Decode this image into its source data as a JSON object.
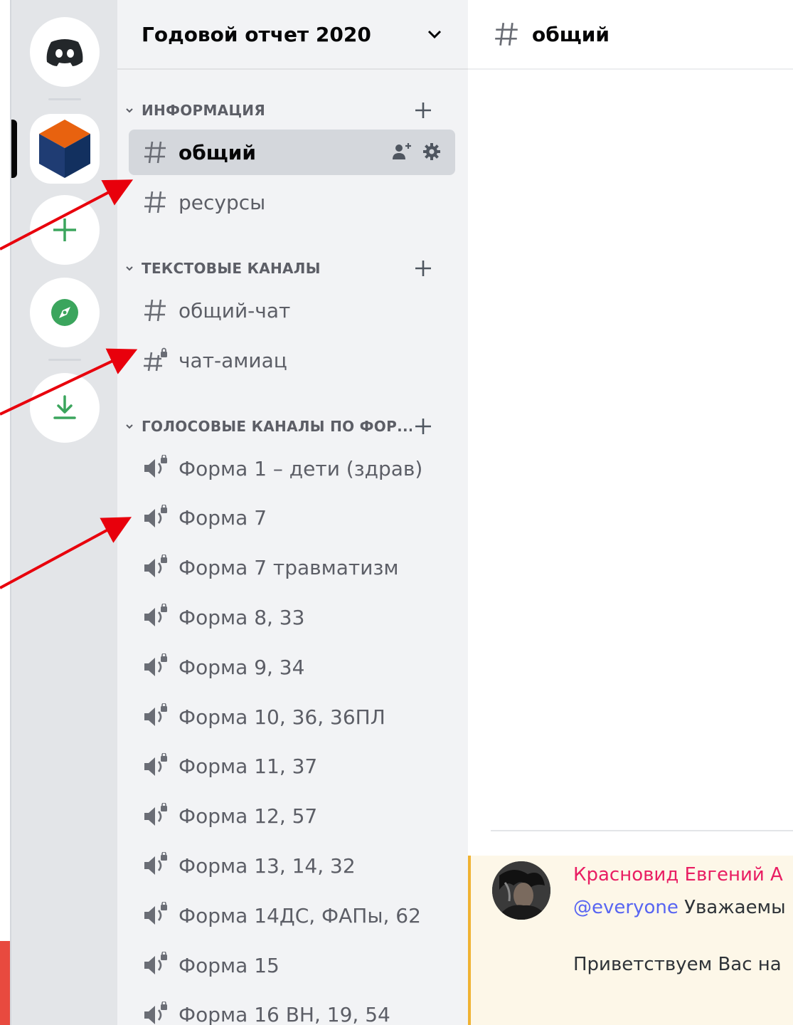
{
  "server": {
    "name": "Годовой отчет 2020"
  },
  "categories": [
    {
      "label": "ИНФОРМАЦИЯ"
    },
    {
      "label": "ТЕКСТОВЫЕ КАНАЛЫ"
    },
    {
      "label": "ГОЛОСОВЫЕ КАНАЛЫ ПО ФОР..."
    }
  ],
  "channels": {
    "info": [
      "общий",
      "ресурсы"
    ],
    "text": [
      "общий-чат",
      "чат-амиац"
    ],
    "voice": [
      "Форма 1 – дети (здрав)",
      "Форма 7",
      "Форма 7 травматизм",
      "Форма 8, 33",
      "Форма 9, 34",
      "Форма 10, 36, 36ПЛ",
      "Форма 11, 37",
      "Форма 12, 57",
      "Форма 13, 14, 32",
      "Форма 14ДС, ФАПы, 62",
      "Форма 15",
      "Форма 16 ВН, 19, 54"
    ]
  },
  "current_channel": {
    "name": "общий"
  },
  "message": {
    "author": "Красновид Евгений А",
    "mention": "@everyone",
    "text1": " Уважаемы",
    "text2": "Приветствуем Вас на"
  },
  "icons": {
    "home": "discord-logo-icon",
    "add_server": "plus-icon",
    "explore": "compass-icon",
    "download": "download-icon",
    "text_channel": "hash-icon",
    "rules_channel": "locked-hash-icon",
    "voice_channel": "speaker-icon",
    "invite": "add-user-icon",
    "settings": "gear-icon"
  },
  "colors": {
    "accent_green": "#3ba55d",
    "author_pink": "#e91e63",
    "mention_blue": "#5865f2",
    "highlight_bar": "#f0b232",
    "annotation_red": "#e8000c"
  }
}
